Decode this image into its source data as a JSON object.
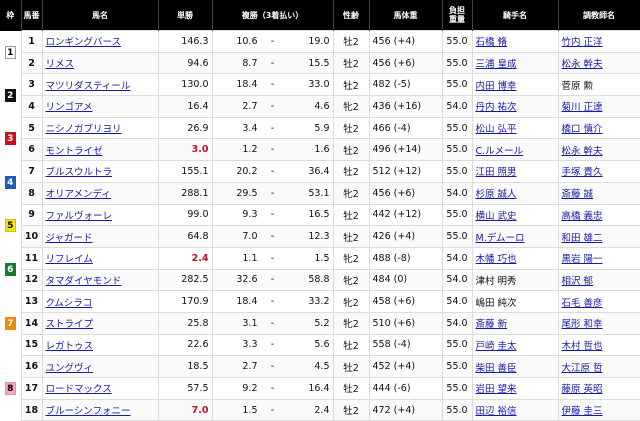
{
  "headers": {
    "waku": "枠",
    "umaban": "馬番",
    "horse": "馬名",
    "tansho": "単勝",
    "fukusho": "複勝（3着払い）",
    "seirei": "性齢",
    "weight": "馬体重",
    "burden": "負担\n重量",
    "jockey": "騎手名",
    "trainer": "調教師名"
  },
  "waku_colors": {
    "1": {
      "bg": "#ffffff",
      "fg": "#000000",
      "border": "#999999"
    },
    "2": {
      "bg": "#111111",
      "fg": "#ffffff",
      "border": "#111111"
    },
    "3": {
      "bg": "#c8101e",
      "fg": "#ffffff",
      "border": "#c8101e"
    },
    "4": {
      "bg": "#1e5bbf",
      "fg": "#ffffff",
      "border": "#1e5bbf"
    },
    "5": {
      "bg": "#f5e600",
      "fg": "#000000",
      "border": "#d0c000"
    },
    "6": {
      "bg": "#1c7a2d",
      "fg": "#ffffff",
      "border": "#1c7a2d"
    },
    "7": {
      "bg": "#f08a00",
      "fg": "#ffffff",
      "border": "#f08a00"
    },
    "8": {
      "bg": "#f6a7c1",
      "fg": "#000000",
      "border": "#e090a8"
    }
  },
  "rows": [
    {
      "waku": "1",
      "umaban": "1",
      "horse": "ロンギングバース",
      "horse_link": true,
      "tansho": "146.3",
      "hot": false,
      "fuku_min": "10.6",
      "fuku_max": "19.0",
      "seirei": "牡2",
      "weight": "456 (+4)",
      "burden": "55.0",
      "jockey": "石橋 脩",
      "jockey_link": true,
      "trainer": "竹内 正洋",
      "trainer_link": true
    },
    {
      "waku": "1",
      "umaban": "2",
      "horse": "リメス",
      "horse_link": true,
      "tansho": "94.6",
      "hot": false,
      "fuku_min": "8.7",
      "fuku_max": "15.5",
      "seirei": "牡2",
      "weight": "456 (+6)",
      "burden": "55.0",
      "jockey": "三浦 皇成",
      "jockey_link": true,
      "trainer": "松永 幹夫",
      "trainer_link": true
    },
    {
      "waku": "2",
      "umaban": "3",
      "horse": "マツリダスティール",
      "horse_link": true,
      "tansho": "130.0",
      "hot": false,
      "fuku_min": "18.4",
      "fuku_max": "33.0",
      "seirei": "牡2",
      "weight": "482 (-5)",
      "burden": "55.0",
      "jockey": "内田 博幸",
      "jockey_link": true,
      "trainer": "菅原 勲",
      "trainer_link": false
    },
    {
      "waku": "2",
      "umaban": "4",
      "horse": "リンゴアメ",
      "horse_link": true,
      "tansho": "16.4",
      "hot": false,
      "fuku_min": "2.7",
      "fuku_max": "4.6",
      "seirei": "牝2",
      "weight": "436 (+16)",
      "burden": "54.0",
      "jockey": "丹内 祐次",
      "jockey_link": true,
      "trainer": "菊川 正達",
      "trainer_link": true
    },
    {
      "waku": "3",
      "umaban": "5",
      "horse": "ニシノガブリヨリ",
      "horse_link": true,
      "tansho": "26.9",
      "hot": false,
      "fuku_min": "3.4",
      "fuku_max": "5.9",
      "seirei": "牡2",
      "weight": "466 (-4)",
      "burden": "55.0",
      "jockey": "松山 弘平",
      "jockey_link": true,
      "trainer": "橋口 慎介",
      "trainer_link": true
    },
    {
      "waku": "3",
      "umaban": "6",
      "horse": "モントライゼ",
      "horse_link": true,
      "tansho": "3.0",
      "hot": true,
      "fuku_min": "1.2",
      "fuku_max": "1.6",
      "seirei": "牡2",
      "weight": "496 (+14)",
      "burden": "55.0",
      "jockey": "C.ルメール",
      "jockey_link": true,
      "trainer": "松永 幹夫",
      "trainer_link": true
    },
    {
      "waku": "4",
      "umaban": "7",
      "horse": "ブルスウルトラ",
      "horse_link": true,
      "tansho": "155.1",
      "hot": false,
      "fuku_min": "20.2",
      "fuku_max": "36.4",
      "seirei": "牡2",
      "weight": "512 (+12)",
      "burden": "55.0",
      "jockey": "江田 照男",
      "jockey_link": true,
      "trainer": "手塚 貴久",
      "trainer_link": true
    },
    {
      "waku": "4",
      "umaban": "8",
      "horse": "オリアメンディ",
      "horse_link": true,
      "tansho": "288.1",
      "hot": false,
      "fuku_min": "29.5",
      "fuku_max": "53.1",
      "seirei": "牝2",
      "weight": "456 (+6)",
      "burden": "54.0",
      "jockey": "杉原 誠人",
      "jockey_link": true,
      "trainer": "斎藤 誠",
      "trainer_link": true
    },
    {
      "waku": "5",
      "umaban": "9",
      "horse": "ファルヴォーレ",
      "horse_link": true,
      "tansho": "99.0",
      "hot": false,
      "fuku_min": "9.3",
      "fuku_max": "16.5",
      "seirei": "牡2",
      "weight": "442 (+12)",
      "burden": "55.0",
      "jockey": "横山 武史",
      "jockey_link": true,
      "trainer": "高橋 義忠",
      "trainer_link": true
    },
    {
      "waku": "5",
      "umaban": "10",
      "horse": "ジャガード",
      "horse_link": true,
      "tansho": "64.8",
      "hot": false,
      "fuku_min": "7.0",
      "fuku_max": "12.3",
      "seirei": "牡2",
      "weight": "426 (+4)",
      "burden": "55.0",
      "jockey": "M.デムーロ",
      "jockey_link": true,
      "trainer": "和田 雄二",
      "trainer_link": true
    },
    {
      "waku": "6",
      "umaban": "11",
      "horse": "リフレイム",
      "horse_link": true,
      "tansho": "2.4",
      "hot": true,
      "fuku_min": "1.1",
      "fuku_max": "1.5",
      "seirei": "牝2",
      "weight": "488 (-8)",
      "burden": "54.0",
      "jockey": "木幡 巧也",
      "jockey_link": true,
      "trainer": "黒岩 陽一",
      "trainer_link": true
    },
    {
      "waku": "6",
      "umaban": "12",
      "horse": "タマダイヤモンド",
      "horse_link": true,
      "tansho": "282.5",
      "hot": false,
      "fuku_min": "32.6",
      "fuku_max": "58.8",
      "seirei": "牝2",
      "weight": "484 (0)",
      "burden": "54.0",
      "jockey": "津村 明秀",
      "jockey_link": false,
      "trainer": "相沢 郁",
      "trainer_link": true
    },
    {
      "waku": "7",
      "umaban": "13",
      "horse": "クムシラコ",
      "horse_link": true,
      "tansho": "170.9",
      "hot": false,
      "fuku_min": "18.4",
      "fuku_max": "33.2",
      "seirei": "牝2",
      "weight": "458 (+6)",
      "burden": "54.0",
      "jockey": "嶋田 純次",
      "jockey_link": false,
      "trainer": "石毛 善彦",
      "trainer_link": true
    },
    {
      "waku": "7",
      "umaban": "14",
      "horse": "ストライプ",
      "horse_link": true,
      "tansho": "25.8",
      "hot": false,
      "fuku_min": "3.1",
      "fuku_max": "5.2",
      "seirei": "牝2",
      "weight": "510 (+6)",
      "burden": "54.0",
      "jockey": "斎藤 新",
      "jockey_link": true,
      "trainer": "尾形 和幸",
      "trainer_link": true
    },
    {
      "waku": "7",
      "umaban": "15",
      "horse": "レガトゥス",
      "horse_link": true,
      "tansho": "22.6",
      "hot": false,
      "fuku_min": "3.3",
      "fuku_max": "5.6",
      "seirei": "牡2",
      "weight": "558 (-4)",
      "burden": "55.0",
      "jockey": "戸崎 圭太",
      "jockey_link": true,
      "trainer": "木村 哲也",
      "trainer_link": true
    },
    {
      "waku": "8",
      "umaban": "16",
      "horse": "ユングヴィ",
      "horse_link": true,
      "tansho": "18.5",
      "hot": false,
      "fuku_min": "2.7",
      "fuku_max": "4.5",
      "seirei": "牡2",
      "weight": "452 (+4)",
      "burden": "55.0",
      "jockey": "柴田 善臣",
      "jockey_link": true,
      "trainer": "大江原 哲",
      "trainer_link": true
    },
    {
      "waku": "8",
      "umaban": "17",
      "horse": "ロードマックス",
      "horse_link": true,
      "tansho": "57.5",
      "hot": false,
      "fuku_min": "9.2",
      "fuku_max": "16.4",
      "seirei": "牡2",
      "weight": "444 (-6)",
      "burden": "55.0",
      "jockey": "岩田 望来",
      "jockey_link": true,
      "trainer": "藤原 英昭",
      "trainer_link": true
    },
    {
      "waku": "8",
      "umaban": "18",
      "horse": "ブルーシンフォニー",
      "horse_link": true,
      "tansho": "7.0",
      "hot": true,
      "fuku_min": "1.5",
      "fuku_max": "2.4",
      "seirei": "牡2",
      "weight": "472 (+4)",
      "burden": "55.0",
      "jockey": "田辺 裕信",
      "jockey_link": true,
      "trainer": "伊藤 圭三",
      "trainer_link": true
    }
  ],
  "fuku_separator": "-"
}
